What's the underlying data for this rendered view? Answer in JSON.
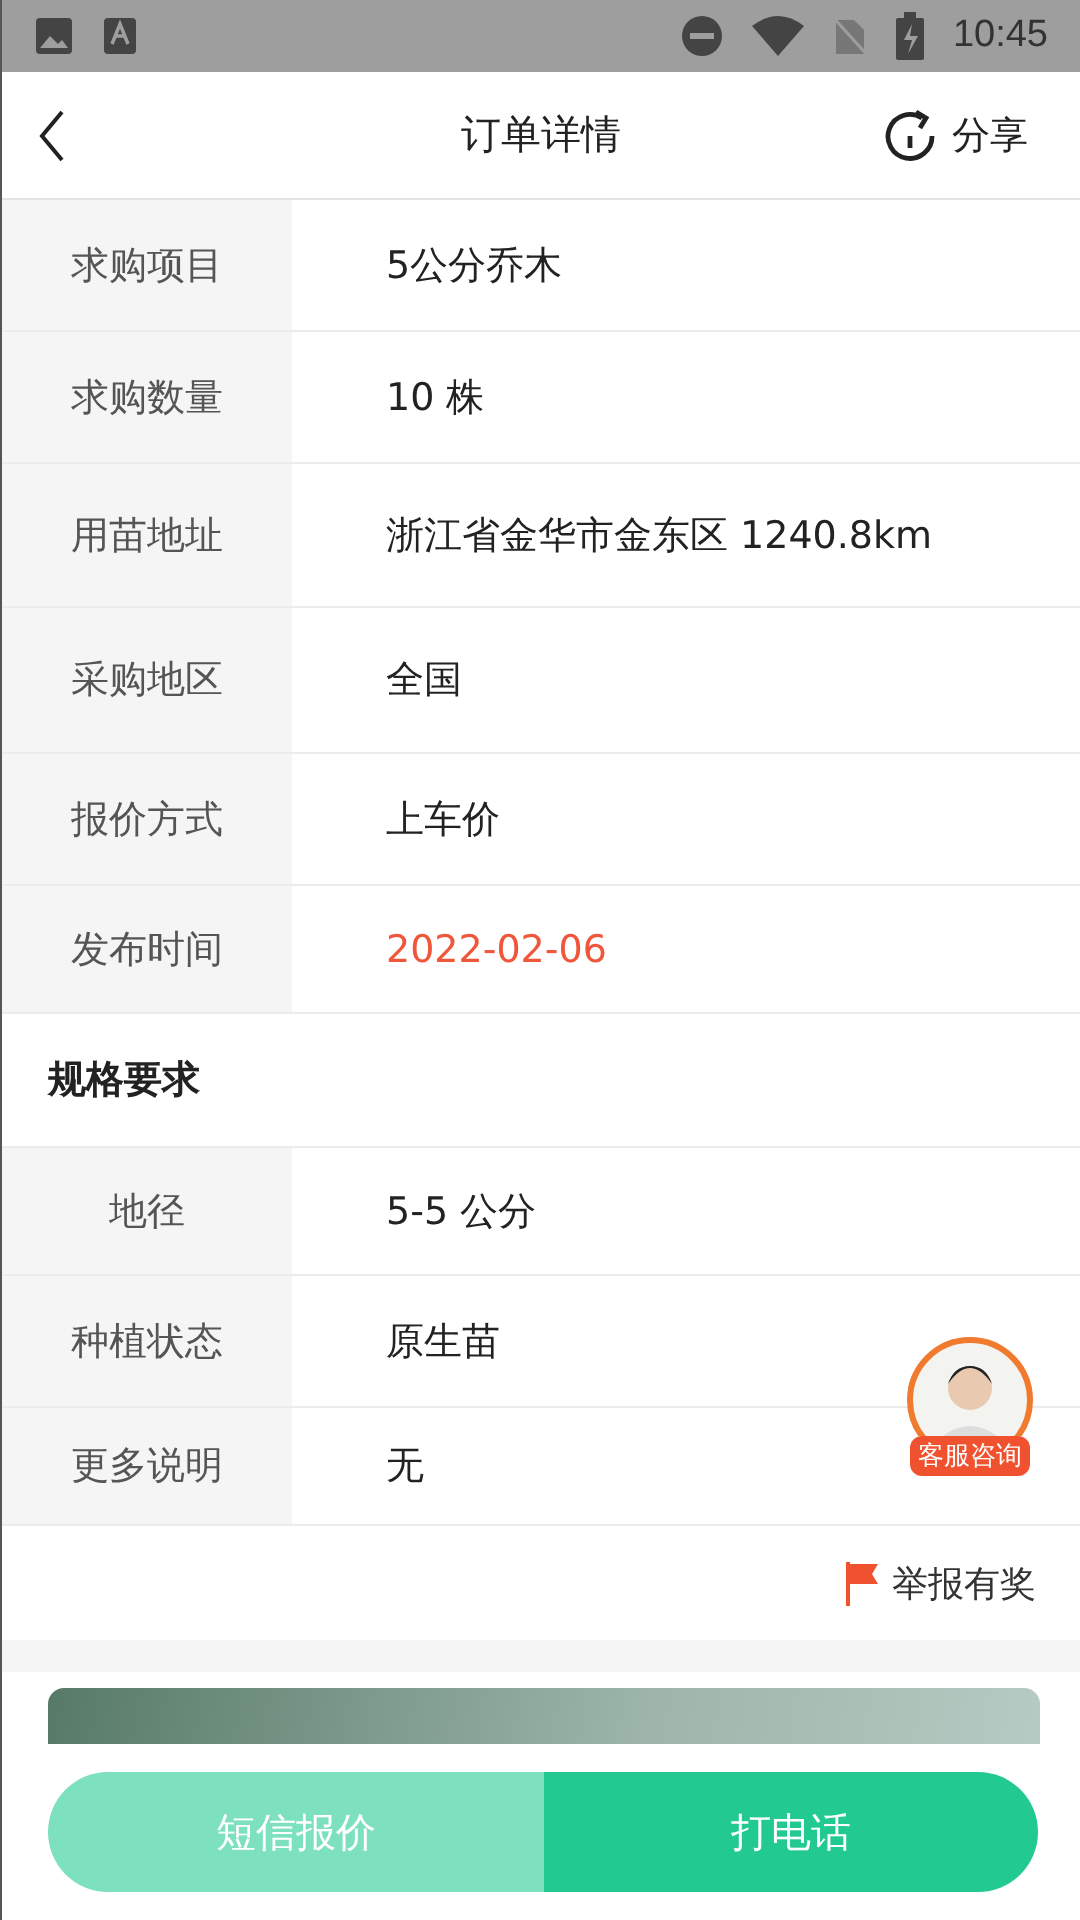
{
  "status_bar": {
    "time": "10:45"
  },
  "nav": {
    "title": "订单详情",
    "share": "分享"
  },
  "details": [
    {
      "label": "求购项目",
      "value": "5公分乔木",
      "highlight": false
    },
    {
      "label": "求购数量",
      "value": "10 株",
      "highlight": false
    },
    {
      "label": "用苗地址",
      "value": "浙江省金华市金东区 1240.8km",
      "highlight": false
    },
    {
      "label": "采购地区",
      "value": "全国",
      "highlight": false
    },
    {
      "label": "报价方式",
      "value": "上车价",
      "highlight": false
    },
    {
      "label": "发布时间",
      "value": "2022-02-06",
      "highlight": true
    }
  ],
  "spec_section": {
    "title": "规格要求"
  },
  "specs": [
    {
      "label": "地径",
      "value": "5-5 公分"
    },
    {
      "label": "种植状态",
      "value": "原生苗"
    },
    {
      "label": "更多说明",
      "value": "无"
    }
  ],
  "support_badge": {
    "label": "客服咨询"
  },
  "report": {
    "label": "举报有奖"
  },
  "actions": [
    {
      "label": "短信报价",
      "kind": "secondary"
    },
    {
      "label": "打电话",
      "kind": "primary"
    }
  ]
}
